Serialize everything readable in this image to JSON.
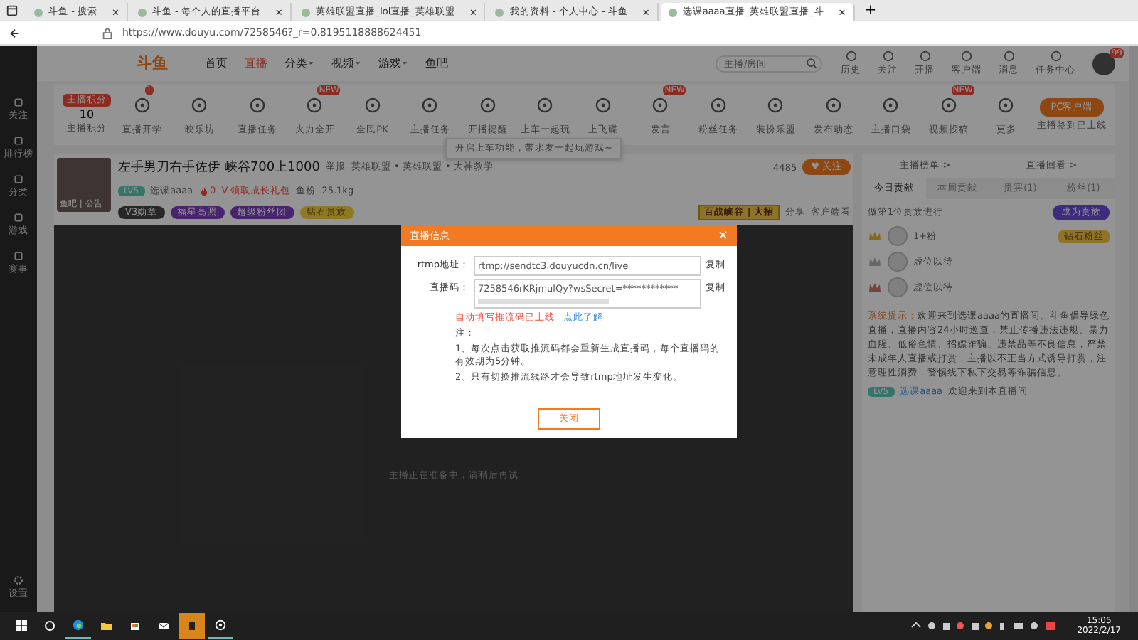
{
  "browser": {
    "tabs": [
      {
        "title": "斗鱼 - 搜索",
        "selected": false,
        "close": "✕"
      },
      {
        "title": "斗鱼 - 每个人的直播平台",
        "selected": false,
        "close": "✕"
      },
      {
        "title": "英雄联盟直播_lol直播_英雄联盟",
        "selected": false,
        "close": "✕"
      },
      {
        "title": "我的资料 - 个人中心 - 斗鱼",
        "selected": false,
        "close": "✕"
      },
      {
        "title": "选课aaaa直播_英雄联盟直播_斗",
        "selected": true,
        "close": "✕"
      }
    ],
    "new_tab": "+",
    "url": "https://www.douyu.com/7258546?_r=0.8195118888624451"
  },
  "sidebar": {
    "items": [
      {
        "label": "关注"
      },
      {
        "label": "排行榜"
      },
      {
        "label": "分类"
      },
      {
        "label": "游戏"
      },
      {
        "label": "赛事"
      }
    ],
    "bottom": "设置"
  },
  "header": {
    "logo": "斗鱼",
    "links": [
      {
        "label": "首页",
        "selected": false,
        "dropdown": false
      },
      {
        "label": "直播",
        "selected": true,
        "dropdown": false
      },
      {
        "label": "分类",
        "selected": false,
        "dropdown": true
      },
      {
        "label": "视频",
        "selected": false,
        "dropdown": true
      },
      {
        "label": "游戏",
        "selected": false,
        "dropdown": true
      },
      {
        "label": "鱼吧",
        "selected": false,
        "dropdown": false
      }
    ],
    "search": {
      "placeholder": "主播/房间"
    },
    "actions": [
      {
        "label": "历史"
      },
      {
        "label": "关注"
      },
      {
        "label": "开播"
      },
      {
        "label": "客户端"
      },
      {
        "label": "消息"
      },
      {
        "label": "任务中心"
      }
    ],
    "avatar_badge": "99"
  },
  "toolbar": {
    "score": {
      "tag": "主播积分",
      "value": "10",
      "label": "主播积分"
    },
    "items": [
      {
        "label": "直播开学",
        "badge": "1"
      },
      {
        "label": "映乐坊"
      },
      {
        "label": "直播任务"
      },
      {
        "label": "火力全开",
        "badge": "NEW"
      },
      {
        "label": "全民PK"
      },
      {
        "label": "主播任务"
      },
      {
        "label": "开播提醒"
      },
      {
        "label": "上车一起玩"
      },
      {
        "label": "上飞碟"
      },
      {
        "label": "发言",
        "badge": "NEW"
      },
      {
        "label": "粉丝任务"
      },
      {
        "label": "装扮乐盟"
      },
      {
        "label": "发布动态"
      },
      {
        "label": "主播口袋"
      },
      {
        "label": "视频投稿",
        "badge": "NEW"
      },
      {
        "label": "更多"
      }
    ],
    "client_button": "PC客户端",
    "client_note": "主播签到已上线",
    "tooltip": "开启上车功能，带水友一起玩游戏~"
  },
  "room": {
    "cover_caption": "鱼吧 | 公告",
    "title": "左手男刀右手佐伊 峡谷700上1000",
    "report": "举报",
    "category": "英雄联盟 • 英雄联盟 • 大神教学",
    "level": "LV5",
    "streamer": "选课aaaa",
    "heat": "0",
    "promo": "V 领取成长礼包",
    "fans": "鱼粉",
    "weight": "25.1kg",
    "badges": [
      "V3勋章",
      "福星高照",
      "超级粉丝团",
      "钻石贵族"
    ],
    "followers": "4485",
    "follow_button": "♥ 关注",
    "event_banner": "百战峡谷 | 大招",
    "share": "分享",
    "client_watch": "客户端看"
  },
  "video": {
    "status": "主播正在准备中，请稍后再试"
  },
  "right_panel": {
    "links": [
      "主播榜单 >",
      "直播回看 >"
    ],
    "tabs": [
      {
        "label": "今日贡献",
        "selected": true
      },
      {
        "label": "本周贡献",
        "selected": false
      },
      {
        "label": "贵宾(1)",
        "selected": false
      },
      {
        "label": "粉丝(1)",
        "selected": false
      }
    ],
    "rank_hint": "做第1位贵族进行",
    "noble_button": "成为贵族",
    "ranks": [
      {
        "name": "1+粉",
        "kind": "gold",
        "badge": "钻石粉丝"
      },
      {
        "name": "虚位以待",
        "kind": "silver"
      },
      {
        "name": "虚位以待",
        "kind": "bronze"
      }
    ],
    "notice_label": "系统提示：",
    "notice": "欢迎来到选课aaaa的直播间。斗鱼倡导绿色直播，直播内容24小时巡查，禁止传播违法违规、暴力血腥、低俗色情、招嫖诈骗、违禁品等不良信息，严禁未成年人直播或打赏，主播以不正当方式诱导打赏，注意理性消费，警惕线下私下交易等诈骗信息。",
    "welcome": {
      "tag": "LV5",
      "user": "选课aaaa",
      "text": "欢迎来到本直播间"
    }
  },
  "modal": {
    "title": "直播信息",
    "close": "×",
    "fields": [
      {
        "label": "rtmp地址：",
        "value": "rtmp://sendtc3.douyucdn.cn/live",
        "copy": "复制"
      },
      {
        "label": "直播码：",
        "value": "7258546rKRjmulQy?wsSecret=************",
        "copy": "复制"
      }
    ],
    "warning": "自动填写推流码已上线",
    "link": "点此了解",
    "note_title": "注：",
    "notes": [
      "1、每次点击获取推流码都会重新生成直播码，每个直播码的有效期为5分钟。",
      "2、只有切换推流线路才会导致rtmp地址发生变化。"
    ],
    "button": "关闭"
  },
  "taskbar": {
    "time": "15:05",
    "date": "2022/2/17"
  }
}
